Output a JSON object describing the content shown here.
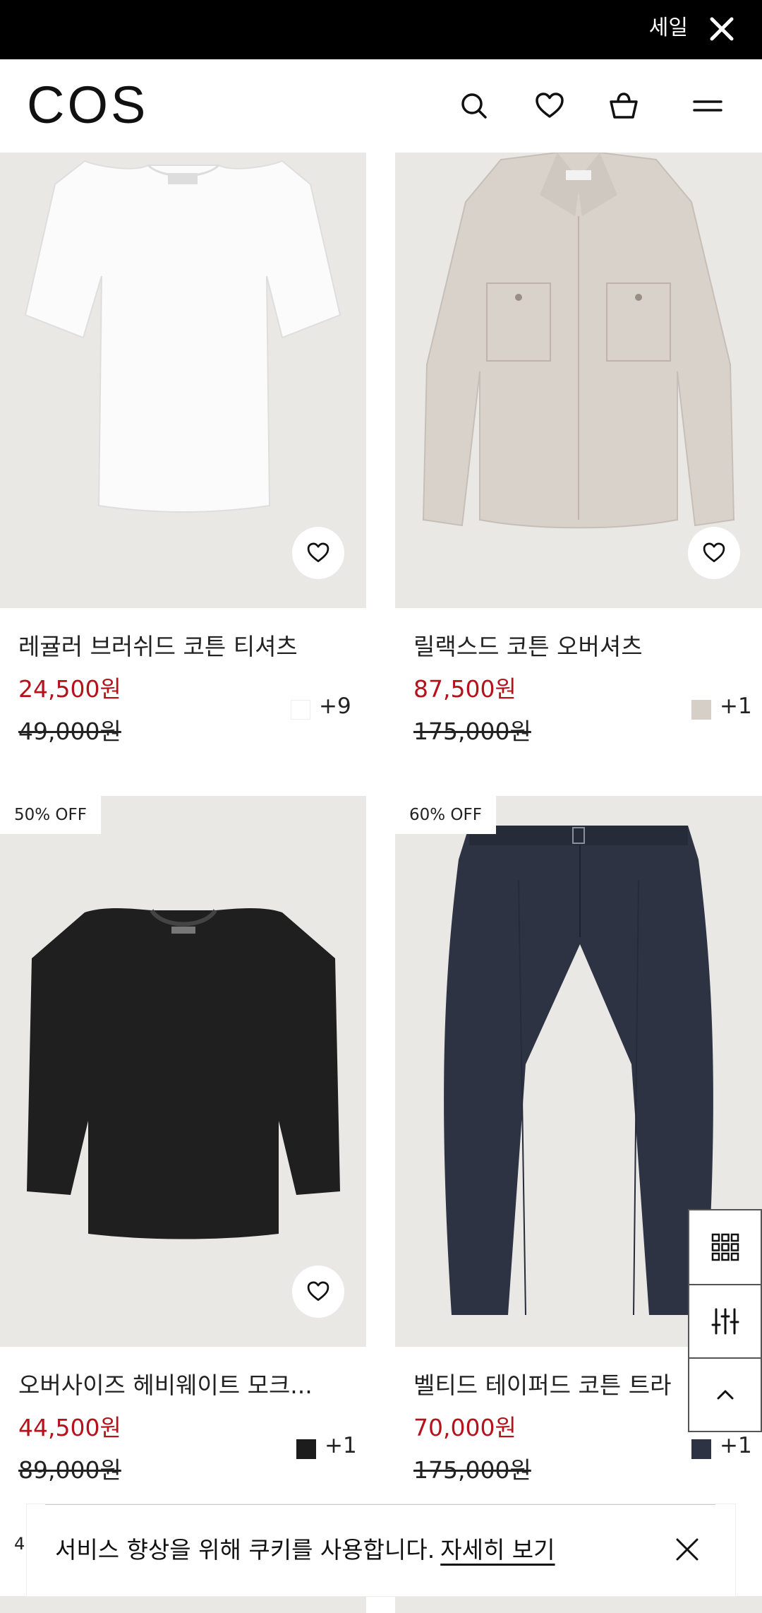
{
  "banner": {
    "text": "세일"
  },
  "header": {
    "logo": "COS"
  },
  "products": [
    {
      "name": "레귤러 브러쉬드 코튼 티셔츠",
      "price": "24,500원",
      "original_price": "49,000원",
      "more_colors": "+9",
      "swatch_color": "#ffffff",
      "badge": ""
    },
    {
      "name": "릴랙스드 코튼 오버셔츠",
      "price": "87,500원",
      "original_price": "175,000원",
      "more_colors": "+1",
      "swatch_color": "#d6cfc7",
      "badge": ""
    },
    {
      "name": "오버사이즈 헤비웨이트 모크...",
      "price": "44,500원",
      "original_price": "89,000원",
      "more_colors": "+1",
      "swatch_color": "#1c1c1c",
      "badge": "50% OFF"
    },
    {
      "name": "벨티드 테이퍼드 코튼 트라",
      "price": "70,000원",
      "original_price": "175,000원",
      "more_colors": "+1",
      "swatch_color": "#2e3344",
      "badge": "60% OFF"
    }
  ],
  "cookie": {
    "text": "서비스 향상을 위해 쿠키를 사용합니다.",
    "link": "자세히 보기"
  },
  "peek_label": "4(",
  "colors": {
    "sale_price": "#b5121b",
    "image_bg": "#e9e8e4"
  },
  "icons": [
    "close-icon",
    "search-icon",
    "heart-icon",
    "bag-icon",
    "menu-icon",
    "grid-view-icon",
    "filter-icon",
    "chevron-up-icon"
  ]
}
